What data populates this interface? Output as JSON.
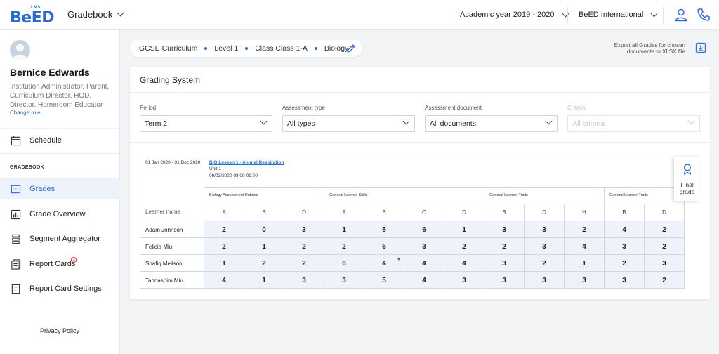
{
  "header": {
    "logo_text": "BeED",
    "logo_badge": "LMS",
    "app_switcher_label": "Gradebook",
    "academic_year": "Academic year 2019 - 2020",
    "organization": "BeED International",
    "icons": [
      "user-icon",
      "phone-icon"
    ]
  },
  "user": {
    "name": "Bernice Edwards",
    "roles": "Institution Administrator, Parent, Curriculum Director, HOD, Director, Homeroom Educator",
    "change_role": "Change role"
  },
  "sidebar": {
    "schedule_label": "Schedule",
    "section_label": "GRADEBOOK",
    "items": [
      {
        "label": "Grades",
        "icon": "grades-icon",
        "active": true
      },
      {
        "label": "Grade Overview",
        "icon": "grade-overview-icon"
      },
      {
        "label": "Segment Aggregator",
        "icon": "segment-aggregator-icon"
      },
      {
        "label": "Report Cards",
        "icon": "report-cards-icon",
        "badge": "3"
      },
      {
        "label": "Report Card Settings",
        "icon": "report-card-settings-icon"
      }
    ],
    "privacy": "Privacy Policy"
  },
  "breadcrumb": {
    "items": [
      "IGCSE Curriculum",
      "Level 1",
      "Class Class 1-A",
      "Biology"
    ]
  },
  "export": {
    "text": "Export all Grades for chosen documents to XLSX file"
  },
  "panel": {
    "title": "Grading System",
    "filters": [
      {
        "label": "Period",
        "value": "Term 2",
        "disabled": false
      },
      {
        "label": "Assessment type",
        "value": "All types",
        "disabled": false
      },
      {
        "label": "Assessment document",
        "value": "All documents",
        "disabled": false
      },
      {
        "label": "Criteria",
        "value": "All criteria",
        "disabled": true
      }
    ]
  },
  "table": {
    "date_range": "01 Jan 2020 - 31 Dec 2020",
    "lesson_title": "BIO Lesson 1 - Animal Respiration",
    "lesson_unit": "Unit 1",
    "lesson_time": "09/03/2020 08:00-09:00",
    "learner_header": "Learner name",
    "groups": [
      {
        "label": "Biology Assessment Rubrics",
        "span": 3
      },
      {
        "label": "General Learner Skills",
        "span": 4
      },
      {
        "label": "General Learner Traits",
        "span": 3
      },
      {
        "label": "General Learner Traits",
        "span": 2
      }
    ],
    "columns": [
      "A",
      "B",
      "D",
      "A",
      "B",
      "C",
      "D",
      "B",
      "D",
      "H",
      "B",
      "D"
    ],
    "rows": [
      {
        "name": "Adam Johnson",
        "grades": [
          "2",
          "0",
          "3",
          "1",
          "5",
          "6",
          "1",
          "3",
          "3",
          "2",
          "4",
          "2"
        ]
      },
      {
        "name": "Felicia Miu",
        "grades": [
          "2",
          "1",
          "2",
          "2",
          "6",
          "3",
          "2",
          "2",
          "3",
          "4",
          "3",
          "2"
        ]
      },
      {
        "name": "Shafiq Melison",
        "grades": [
          "1",
          "2",
          "2",
          "6",
          "4",
          "4",
          "4",
          "3",
          "2",
          "1",
          "2",
          "3"
        ],
        "starred_col": 4
      },
      {
        "name": "Tannashim Miu",
        "grades": [
          "4",
          "1",
          "3",
          "3",
          "5",
          "4",
          "3",
          "3",
          "3",
          "3",
          "3",
          "2"
        ]
      }
    ],
    "final_grade_label": "Final grade",
    "star_mark": "*"
  }
}
